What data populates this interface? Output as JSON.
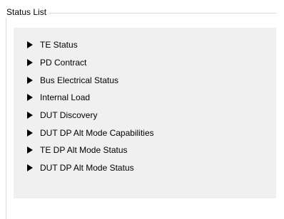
{
  "group": {
    "title": "Status List"
  },
  "items": [
    {
      "label": "TE Status"
    },
    {
      "label": "PD Contract"
    },
    {
      "label": "Bus Electrical Status"
    },
    {
      "label": "Internal Load"
    },
    {
      "label": "DUT Discovery"
    },
    {
      "label": "DUT DP Alt Mode Capabilities"
    },
    {
      "label": "TE DP Alt Mode Status"
    },
    {
      "label": "DUT DP Alt Mode Status"
    }
  ],
  "icons": {
    "collapsed": "expand-arrow-icon"
  }
}
